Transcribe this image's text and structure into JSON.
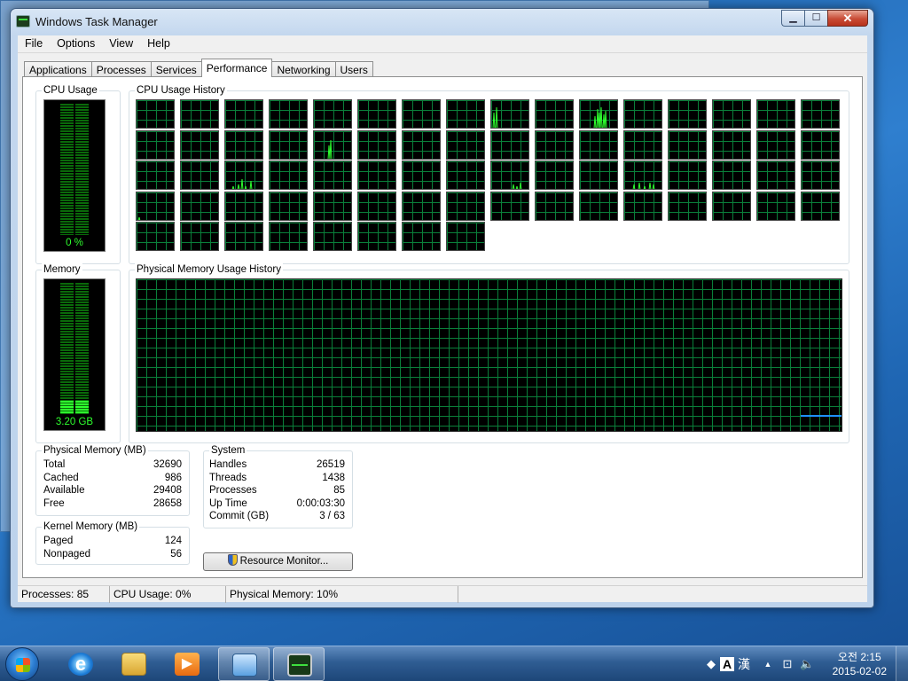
{
  "window": {
    "title": "Windows Task Manager",
    "minimize": "▁",
    "maximize": "☐",
    "close": "✕"
  },
  "menu": [
    "File",
    "Options",
    "View",
    "Help"
  ],
  "tabs": [
    {
      "label": "Applications",
      "active": false
    },
    {
      "label": "Processes",
      "active": false
    },
    {
      "label": "Services",
      "active": false
    },
    {
      "label": "Performance",
      "active": true
    },
    {
      "label": "Networking",
      "active": false
    },
    {
      "label": "Users",
      "active": false
    }
  ],
  "performance": {
    "cpu_usage": {
      "label": "CPU Usage",
      "value_text": "0 %",
      "level": 0.0
    },
    "cpu_history": {
      "label": "CPU Usage History",
      "cores": 72
    },
    "memory": {
      "label": "Memory",
      "value_text": "3.20 GB",
      "level": 0.1
    },
    "memory_history": {
      "label": "Physical Memory Usage History",
      "level": 0.1
    },
    "physical_memory": {
      "label": "Physical Memory (MB)",
      "rows": [
        {
          "name": "Total",
          "value": "32690"
        },
        {
          "name": "Cached",
          "value": "986"
        },
        {
          "name": "Available",
          "value": "29408"
        },
        {
          "name": "Free",
          "value": "28658"
        }
      ]
    },
    "kernel_memory": {
      "label": "Kernel Memory (MB)",
      "rows": [
        {
          "name": "Paged",
          "value": "124"
        },
        {
          "name": "Nonpaged",
          "value": "56"
        }
      ]
    },
    "system": {
      "label": "System",
      "rows": [
        {
          "name": "Handles",
          "value": "26519"
        },
        {
          "name": "Threads",
          "value": "1438"
        },
        {
          "name": "Processes",
          "value": "85"
        },
        {
          "name": "Up Time",
          "value": "0:00:03:30"
        },
        {
          "name": "Commit (GB)",
          "value": "3 / 63"
        }
      ]
    },
    "resource_monitor_button": "Resource Monitor..."
  },
  "statusbar": {
    "processes": "Processes: 85",
    "cpu": "CPU Usage: 0%",
    "memory": "Physical Memory: 10%"
  },
  "taskbar": {
    "items": [
      "internet-explorer-icon",
      "file-explorer-icon",
      "media-player-icon",
      "remote-desktop-icon",
      "task-manager-icon"
    ],
    "ime_letter": "A",
    "ime_hanja": "漢",
    "clock_time": "오전 2:15",
    "clock_date": "2015-02-02"
  },
  "colors": {
    "graph_green": "#2eff2e",
    "grid_green": "#0a7f3a",
    "memory_line": "#1e90ff"
  }
}
